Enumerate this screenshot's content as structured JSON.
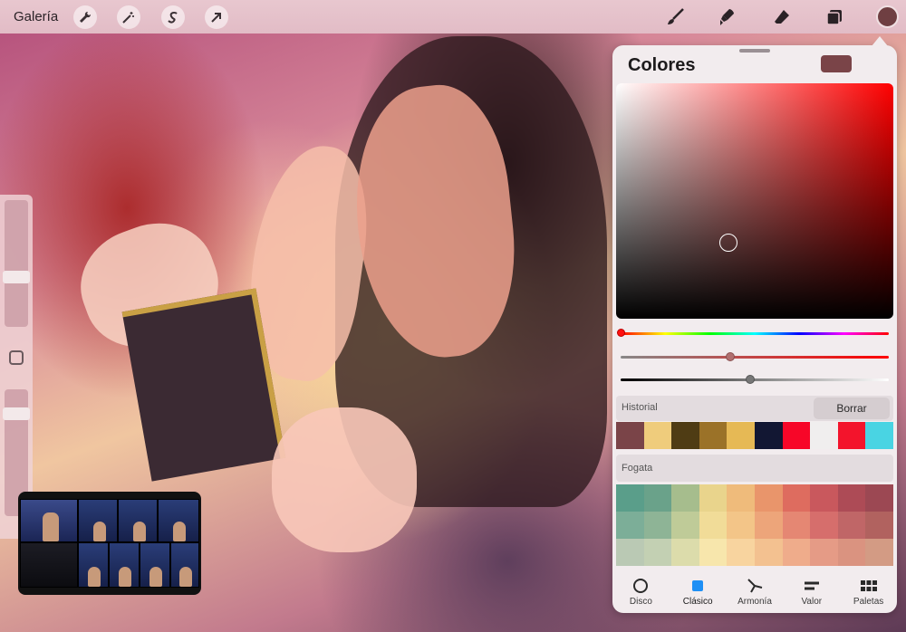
{
  "topbar": {
    "gallery_label": "Galería",
    "left_tools": [
      "wrench-icon",
      "magic-wand-icon",
      "selection-s-icon",
      "move-arrow-icon"
    ],
    "right_tools": [
      "brush-icon",
      "smudge-icon",
      "eraser-icon",
      "layers-icon"
    ],
    "current_color": "#6f3f42"
  },
  "sidebar": {
    "brush_size_level": 0.25,
    "opacity_level": 0.2
  },
  "color_panel": {
    "title": "Colores",
    "current_color": "#7a4448",
    "history": {
      "label": "Historial",
      "clear_label": "Borrar",
      "swatches": [
        "#7a4448",
        "#efcc7c",
        "#4f3c14",
        "#9b7228",
        "#e6b955",
        "#121733",
        "#f70628",
        "#f0eeee",
        "#f3142c",
        "#49d4e3"
      ]
    },
    "palette": {
      "label": "Fogata",
      "swatches": [
        "#5a9e8a",
        "#6aa28a",
        "#a6bd8d",
        "#e9d48c",
        "#efbb7b",
        "#e9956b",
        "#de6c5f",
        "#c9585d",
        "#ad4b56",
        "#9c4853",
        "#7cae98",
        "#8eb496",
        "#bfcb98",
        "#f1dc98",
        "#f3c588",
        "#eda57a",
        "#e58773",
        "#d66e6c",
        "#c06667",
        "#b1625f",
        "#bac9b4",
        "#c3d0b3",
        "#dcdcab",
        "#f7e6ac",
        "#f8d49f",
        "#f3c190",
        "#efac8b",
        "#e59b86",
        "#da9380",
        "#d39b84"
      ]
    },
    "tabs": [
      {
        "label": "Disco",
        "icon": "disc-icon"
      },
      {
        "label": "Clásico",
        "icon": "square-icon"
      },
      {
        "label": "Armonía",
        "icon": "harmony-icon"
      },
      {
        "label": "Valor",
        "icon": "value-icon"
      },
      {
        "label": "Paletas",
        "icon": "palettes-icon"
      }
    ]
  }
}
